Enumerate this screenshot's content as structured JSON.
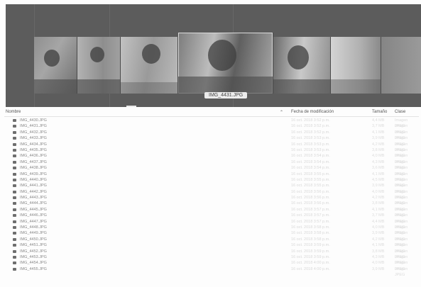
{
  "viewer": {
    "caption": "IMG_4431.JPG"
  },
  "columns": {
    "name": "Nombre",
    "date": "Fecha de modificación",
    "size": "Tamaño",
    "kind": "Clase",
    "sort_indicator": "⌃"
  },
  "files": [
    {
      "name": "IMG_4430.JPG",
      "date": "16 oct. 2018 3:52 p.m.",
      "size": "4,4 MB",
      "kind": "Imagen JPEG"
    },
    {
      "name": "IMG_4431.JPG",
      "date": "16 oct. 2018 3:52 p.m.",
      "size": "3,7 MB",
      "kind": "Imagen JPEG"
    },
    {
      "name": "IMG_4432.JPG",
      "date": "16 oct. 2018 3:52 p.m.",
      "size": "4,1 MB",
      "kind": "Imagen JPEG"
    },
    {
      "name": "IMG_4433.JPG",
      "date": "16 oct. 2018 3:53 p.m.",
      "size": "3,9 MB",
      "kind": "Imagen JPEG"
    },
    {
      "name": "IMG_4434.JPG",
      "date": "16 oct. 2018 3:53 p.m.",
      "size": "4,2 MB",
      "kind": "Imagen JPEG"
    },
    {
      "name": "IMG_4435.JPG",
      "date": "16 oct. 2018 3:53 p.m.",
      "size": "3,8 MB",
      "kind": "Imagen JPEG"
    },
    {
      "name": "IMG_4436.JPG",
      "date": "16 oct. 2018 3:54 p.m.",
      "size": "4,0 MB",
      "kind": "Imagen JPEG"
    },
    {
      "name": "IMG_4437.JPG",
      "date": "16 oct. 2018 3:54 p.m.",
      "size": "4,3 MB",
      "kind": "Imagen JPEG"
    },
    {
      "name": "IMG_4438.JPG",
      "date": "16 oct. 2018 3:54 p.m.",
      "size": "3,6 MB",
      "kind": "Imagen JPEG"
    },
    {
      "name": "IMG_4439.JPG",
      "date": "16 oct. 2018 3:55 p.m.",
      "size": "4,1 MB",
      "kind": "Imagen JPEG"
    },
    {
      "name": "IMG_4440.JPG",
      "date": "16 oct. 2018 3:55 p.m.",
      "size": "4,5 MB",
      "kind": "Imagen JPEG"
    },
    {
      "name": "IMG_4441.JPG",
      "date": "16 oct. 2018 3:55 p.m.",
      "size": "3,9 MB",
      "kind": "Imagen JPEG"
    },
    {
      "name": "IMG_4442.JPG",
      "date": "16 oct. 2018 3:56 p.m.",
      "size": "4,0 MB",
      "kind": "Imagen JPEG"
    },
    {
      "name": "IMG_4443.JPG",
      "date": "16 oct. 2018 3:56 p.m.",
      "size": "4,2 MB",
      "kind": "Imagen JPEG"
    },
    {
      "name": "IMG_4444.JPG",
      "date": "16 oct. 2018 3:56 p.m.",
      "size": "3,8 MB",
      "kind": "Imagen JPEG"
    },
    {
      "name": "IMG_4445.JPG",
      "date": "16 oct. 2018 3:57 p.m.",
      "size": "4,1 MB",
      "kind": "Imagen JPEG"
    },
    {
      "name": "IMG_4446.JPG",
      "date": "16 oct. 2018 3:57 p.m.",
      "size": "3,7 MB",
      "kind": "Imagen JPEG"
    },
    {
      "name": "IMG_4447.JPG",
      "date": "16 oct. 2018 3:57 p.m.",
      "size": "4,4 MB",
      "kind": "Imagen JPEG"
    },
    {
      "name": "IMG_4448.JPG",
      "date": "16 oct. 2018 3:58 p.m.",
      "size": "4,0 MB",
      "kind": "Imagen JPEG"
    },
    {
      "name": "IMG_4449.JPG",
      "date": "16 oct. 2018 3:58 p.m.",
      "size": "3,9 MB",
      "kind": "Imagen JPEG"
    },
    {
      "name": "IMG_4450.JPG",
      "date": "16 oct. 2018 3:58 p.m.",
      "size": "4,2 MB",
      "kind": "Imagen JPEG"
    },
    {
      "name": "IMG_4451.JPG",
      "date": "16 oct. 2018 3:59 p.m.",
      "size": "4,1 MB",
      "kind": "Imagen JPEG"
    },
    {
      "name": "IMG_4452.JPG",
      "date": "16 oct. 2018 3:59 p.m.",
      "size": "3,8 MB",
      "kind": "Imagen JPEG"
    },
    {
      "name": "IMG_4453.JPG",
      "date": "16 oct. 2018 3:59 p.m.",
      "size": "4,3 MB",
      "kind": "Imagen JPEG"
    },
    {
      "name": "IMG_4454.JPG",
      "date": "16 oct. 2018 4:00 p.m.",
      "size": "4,0 MB",
      "kind": "Imagen JPEG"
    },
    {
      "name": "IMG_4455.JPG",
      "date": "16 oct. 2018 4:00 p.m.",
      "size": "3,9 MB",
      "kind": "Imagen JPEG"
    }
  ]
}
